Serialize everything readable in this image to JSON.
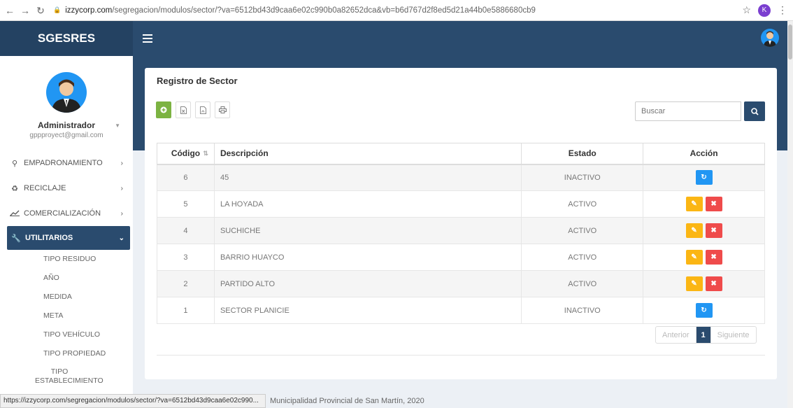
{
  "browser": {
    "url_host": "izzycorp.com",
    "url_path": "/segregacion/modulos/sector/?va=6512bd43d9caa6e02c990b0a82652dca&vb=b6d767d2f8ed5d21a44b0e5886680cb9",
    "profile_initial": "K"
  },
  "header": {
    "brand": "SGESRES"
  },
  "sidebar": {
    "user_name": "Administrador",
    "user_email": "gppproyect@gmail.com",
    "items": [
      {
        "label": "EMPADRONAMIENTO",
        "icon": "map-marker-icon"
      },
      {
        "label": "RECICLAJE",
        "icon": "recycle-icon"
      },
      {
        "label": "COMERCIALIZACIÓN",
        "icon": "chart-line-icon"
      },
      {
        "label": "UTILITARIOS",
        "icon": "wrench-icon"
      }
    ],
    "sub_items": [
      {
        "label": "TIPO RESIDUO"
      },
      {
        "label": "AÑO"
      },
      {
        "label": "MEDIDA"
      },
      {
        "label": "META"
      },
      {
        "label": "TIPO VEHÍCULO"
      },
      {
        "label": "TIPO PROPIEDAD"
      },
      {
        "label": "TIPO ESTABLECIMIENTO"
      }
    ]
  },
  "main": {
    "title": "Registro de Sector",
    "search_placeholder": "Buscar",
    "columns": {
      "code": "Código",
      "description": "Descripción",
      "status": "Estado",
      "action": "Acción"
    },
    "rows": [
      {
        "code": "6",
        "description": "45",
        "status": "INACTIVO"
      },
      {
        "code": "5",
        "description": "LA HOYADA",
        "status": "ACTIVO"
      },
      {
        "code": "4",
        "description": "SUCHICHE",
        "status": "ACTIVO"
      },
      {
        "code": "3",
        "description": "BARRIO HUAYCO",
        "status": "ACTIVO"
      },
      {
        "code": "2",
        "description": "PARTIDO ALTO",
        "status": "ACTIVO"
      },
      {
        "code": "1",
        "description": "SECTOR PLANICIE",
        "status": "INACTIVO"
      }
    ],
    "pagination": {
      "prev": "Anterior",
      "current": "1",
      "next": "Siguiente"
    }
  },
  "status_bar": {
    "link": "https://izzycorp.com/segregacion/modulos/sector/?va=6512bd43d9caa6e02c990..."
  },
  "footer": {
    "text": "Municipalidad Provincial de San Martín, 2020"
  },
  "colors": {
    "primary": "#2a4b6e",
    "add": "#7cb342",
    "refresh": "#2196f3",
    "edit": "#fbb614",
    "delete": "#ef4b4b"
  }
}
